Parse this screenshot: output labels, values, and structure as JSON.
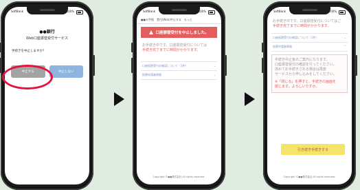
{
  "statusbar": {
    "carrier": "SoftBank",
    "time": "9:41",
    "battery": "100%"
  },
  "phone1": {
    "bank": "●●銀行",
    "service": "Web口座振替受付サービス",
    "question": "手続きを中止しますか？",
    "yes_label": "中止する",
    "no_label": "中止しない"
  },
  "phone2": {
    "tab_home": "●●の手続",
    "tab_cancel": "受付(Web)中止する",
    "tab_more": "もっと",
    "alert": "口座振替受付を中止しました。",
    "info_line1": "お手続き中です。口座振替受付については",
    "info_line2": "手続き完了までに時間がかかります。",
    "accordion1": "口座振替受付の確認について（1件）",
    "accordion2": "振替申請者情報",
    "footer": "Copyright ©●●株式会社 All rights reserved."
  },
  "phone3": {
    "note_line1": "お手続き中です。口座振替受付についてはご",
    "note_line2": "手続き完了までに時間がかかります。",
    "accordion1": "口座振替受付の確認について（1件）",
    "section_title": "振替申請者情報",
    "body_line1": "手続き中止後のご案内になります。",
    "body_line2": "口座振替受付の確認を行ってください。",
    "body_line3": "改めてお手続きされる場合は再度",
    "body_line4": "サービスから申し込みをしてください。",
    "body_red1": "※「閉じる」を押すと、手続きの画面を",
    "body_red2": "閉じます。よろしいですか。",
    "confirm_label": "引き続き手続きする",
    "footer": "Copyright ©●●株式会社 All rights reserved."
  }
}
